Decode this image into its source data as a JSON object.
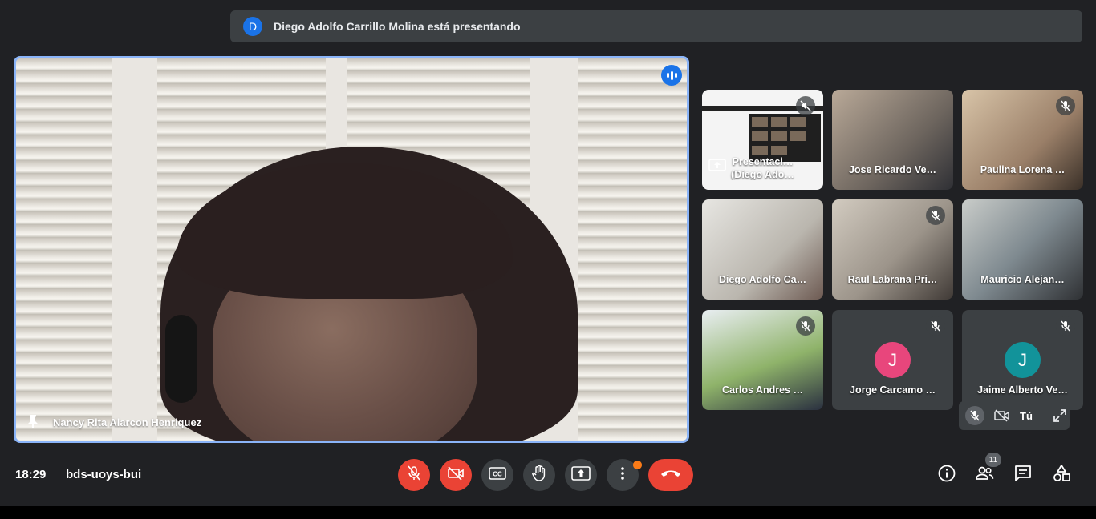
{
  "banner": {
    "avatar_letter": "D",
    "text": "Diego Adolfo Carrillo Molina está presentando"
  },
  "main_tile": {
    "name": "Nancy Rita Alarcon Henriquez"
  },
  "tiles": [
    {
      "name_line1": "Presentaci…",
      "name_line2": "(Diego Ado…"
    },
    {
      "name": "Jose Ricardo Ve…"
    },
    {
      "name": "Paulina Lorena …"
    },
    {
      "name": "Diego Adolfo Ca…"
    },
    {
      "name": "Raul Labrana Pri…"
    },
    {
      "name": "Mauricio Alejan…"
    },
    {
      "name": "Carlos Andres …"
    },
    {
      "name": "Jorge Carcamo …",
      "avatar_letter": "J",
      "avatar_color": "#e8467c"
    },
    {
      "name": "Jaime Alberto Ve…",
      "avatar_letter": "J",
      "avatar_color": "#12939a"
    }
  ],
  "self_view": {
    "label": "Tú"
  },
  "bottom_bar": {
    "time": "18:29",
    "meeting_code": "bds-uoys-bui",
    "participants_count": "11"
  },
  "colors": {
    "accent": "#8ab4f8",
    "danger": "#ea4335",
    "notification": "#fa7b17",
    "surface": "#3c4043",
    "background": "#202124"
  }
}
